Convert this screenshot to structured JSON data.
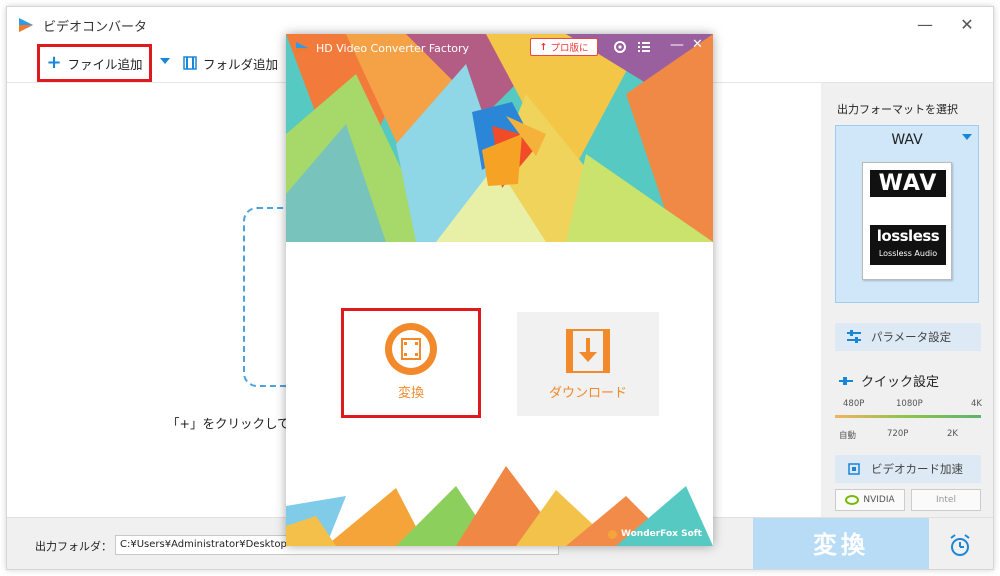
{
  "main_window": {
    "title": "ビデオコンバータ",
    "minimize": "—",
    "close": "✕"
  },
  "toolbar": {
    "add_file_label": "ファイル追加",
    "add_folder_label": "フォルダ追加"
  },
  "drop_hint": "「+」をクリックして",
  "right_panel": {
    "format_title": "出力フォーマットを選択",
    "format_name": "WAV",
    "format_card_top": "WAV",
    "format_card_logo": "lossless",
    "format_card_sub": "Lossless Audio",
    "param_label": "パラメータ設定",
    "quick_title": "クイック設定",
    "quick_top_ticks": [
      "480P",
      "1080P",
      "4K"
    ],
    "quick_bottom_ticks": [
      "自動",
      "720P",
      "2K"
    ],
    "gpu_label": "ビデオカード加速",
    "nvidia_label": "NVIDIA",
    "intel_label": "Intel"
  },
  "bottom": {
    "output_folder_label": "出力フォルダ：",
    "output_path": "C:¥Users¥Administrator¥Desktop",
    "convert_label": "変換"
  },
  "launcher": {
    "title": "HD Video Converter Factory",
    "pro_label": "プロ版に",
    "minimize": "—",
    "close": "✕",
    "convert_label": "変換",
    "download_label": "ダウンロード",
    "brand": "WonderFox Soft"
  },
  "colors": {
    "accent_blue": "#1a86d8",
    "highlight_red": "#e0191e",
    "launcher_orange": "#f08a2a",
    "convert_disabled": "#b8dcf6"
  },
  "icons": {
    "app_logo": "app-logo-icon",
    "add": "plus-icon",
    "folder": "film-folder-icon",
    "param": "sliders-icon",
    "quick": "quick-slider-icon",
    "gpu": "chip-icon",
    "alarm": "alarm-clock-icon",
    "pro": "arrow-up-icon",
    "gear": "gear-icon",
    "list": "list-icon",
    "convert": "film-icon",
    "download": "download-arrow-icon"
  }
}
